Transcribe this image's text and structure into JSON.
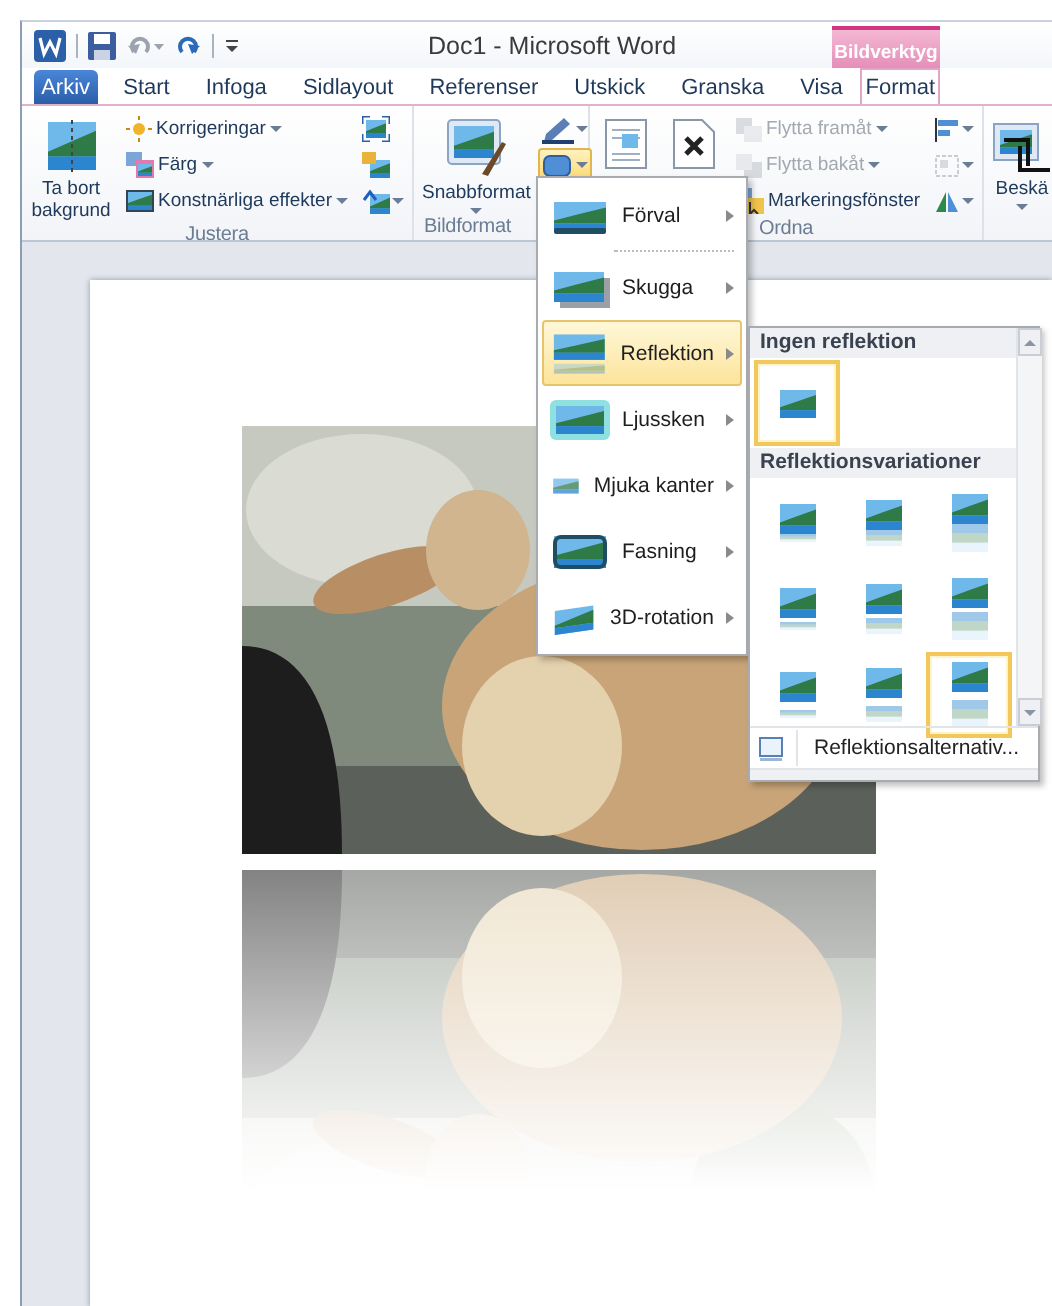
{
  "window": {
    "title": "Doc1 - Microsoft Word",
    "context_label": "Bildverktyg"
  },
  "tabs": [
    {
      "label": "Arkiv",
      "kind": "file",
      "selected": false
    },
    {
      "label": "Start",
      "kind": "normal",
      "selected": false
    },
    {
      "label": "Infoga",
      "kind": "normal",
      "selected": false
    },
    {
      "label": "Sidlayout",
      "kind": "normal",
      "selected": false
    },
    {
      "label": "Referenser",
      "kind": "normal",
      "selected": false
    },
    {
      "label": "Utskick",
      "kind": "normal",
      "selected": false
    },
    {
      "label": "Granska",
      "kind": "normal",
      "selected": false
    },
    {
      "label": "Visa",
      "kind": "normal",
      "selected": false
    },
    {
      "label": "Format",
      "kind": "context",
      "selected": true
    }
  ],
  "ribbon": [
    {
      "label": "Justera",
      "columns": [
        [
          {
            "kind": "large",
            "label": "Ta bort bakgrund",
            "dropdown": false,
            "disabled": false
          }
        ],
        [
          {
            "kind": "small",
            "label": "Korrigeringar",
            "dropdown": true,
            "disabled": false
          },
          {
            "kind": "small",
            "label": "Färg",
            "dropdown": true,
            "disabled": false
          },
          {
            "kind": "small",
            "label": "Konstnärliga effekter",
            "dropdown": true,
            "disabled": false
          }
        ],
        [
          {
            "kind": "icon",
            "dropdown": false,
            "disabled": false
          },
          {
            "kind": "icon",
            "dropdown": false,
            "disabled": false
          },
          {
            "kind": "icon",
            "dropdown": true,
            "disabled": false
          }
        ]
      ]
    },
    {
      "label": "Bildformat",
      "columns": [
        [
          {
            "kind": "large",
            "label": "Snabbformat",
            "dropdown": true,
            "disabled": false
          }
        ],
        [
          {
            "kind": "icon",
            "dropdown": true,
            "disabled": false,
            "active": false
          },
          {
            "kind": "icon",
            "dropdown": true,
            "disabled": false,
            "active": true
          }
        ]
      ]
    },
    {
      "label": "Ordna",
      "columns": [
        [
          {
            "kind": "large",
            "dropdown": false,
            "disabled": false
          }
        ],
        [
          {
            "kind": "large",
            "dropdown": false,
            "disabled": false
          }
        ],
        [
          {
            "kind": "small",
            "label": "Flytta framåt",
            "dropdown": true,
            "disabled": true
          },
          {
            "kind": "small",
            "label": "Flytta bakåt",
            "dropdown": true,
            "disabled": true
          },
          {
            "kind": "small",
            "label": "Markeringsfönster",
            "dropdown": false,
            "disabled": false
          }
        ],
        [
          {
            "kind": "icon",
            "dropdown": true,
            "disabled": false
          },
          {
            "kind": "icon",
            "dropdown": true,
            "disabled": true
          },
          {
            "kind": "icon",
            "dropdown": true,
            "disabled": false
          }
        ]
      ]
    },
    {
      "columns": [
        [
          {
            "kind": "large",
            "label": "Beskä",
            "dropdown": true,
            "disabled": false
          }
        ]
      ]
    }
  ],
  "menu": {
    "items": [
      {
        "label": "Förval",
        "selected": false,
        "separator_after": true
      },
      {
        "label": "Skugga",
        "selected": false,
        "separator_after": false
      },
      {
        "label": "Reflektion",
        "selected": true,
        "separator_after": false
      },
      {
        "label": "Ljussken",
        "selected": false,
        "separator_after": false
      },
      {
        "label": "Mjuka kanter",
        "selected": false,
        "separator_after": false
      },
      {
        "label": "Fasning",
        "selected": false,
        "separator_after": false
      },
      {
        "label": "3D-rotation",
        "selected": false,
        "separator_after": false
      }
    ]
  },
  "gallery": {
    "sections": [
      {
        "title": "Ingen reflektion",
        "kind": "none",
        "items": [
          {
            "selected": true
          }
        ]
      },
      {
        "title": "Reflektionsvariationer",
        "kind": "variations",
        "items": [
          {
            "selected": false
          },
          {
            "selected": false
          },
          {
            "selected": false
          },
          {
            "selected": false
          },
          {
            "selected": false
          },
          {
            "selected": false
          },
          {
            "selected": false
          },
          {
            "selected": false
          },
          {
            "selected": true
          }
        ]
      }
    ],
    "footer": "Reflektionsalternativ..."
  },
  "document": {
    "image": {
      "kind": "picture",
      "reflection": true
    }
  }
}
